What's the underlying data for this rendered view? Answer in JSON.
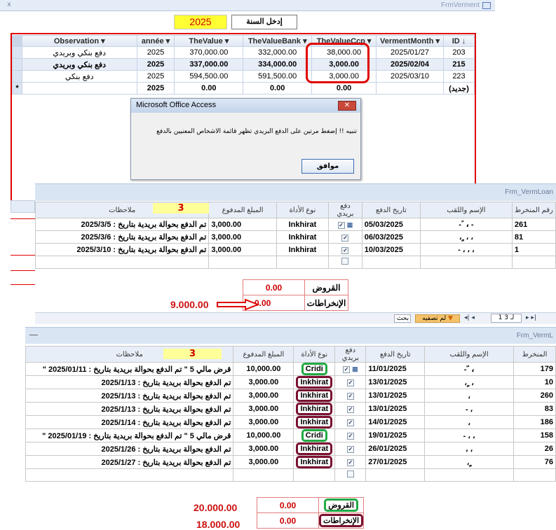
{
  "top_form": {
    "close_glyph": "x",
    "title": "FrmVerment",
    "year_value": "2025",
    "year_label": "إدخل السنة",
    "columns": [
      "Observation",
      "année",
      "TheValue",
      "TheValueBank",
      "TheValueCcp",
      "VermentMonth",
      "ID"
    ],
    "rows": [
      {
        "obs": "دفع بنكي وبريدي",
        "annee": "2025",
        "value": "370,000.00",
        "bank": "332,000.00",
        "ccp": "38,000.00",
        "month": "2025/01/27",
        "id": "203"
      },
      {
        "obs": "دفع بنكي وبريدي",
        "annee": "2025",
        "value": "337,000.00",
        "bank": "334,000.00",
        "ccp": "3,000.00",
        "month": "2025/02/04",
        "id": "215"
      },
      {
        "obs": "دفع بنكي",
        "annee": "2025",
        "value": "594,500.00",
        "bank": "591,500.00",
        "ccp": "3,000.00",
        "month": "2025/03/10",
        "id": "223"
      },
      {
        "obs": "",
        "annee": "2025",
        "value": "0.00",
        "bank": "0.00",
        "ccp": "0.00",
        "month": "",
        "id": "(جديد)"
      }
    ],
    "new_row_marker": "*"
  },
  "dialog": {
    "title": "Microsoft Office Access",
    "close": "✕",
    "message": "تنبيه !! إضغط مرتين على الدفع البريدي تظهر قائمة الاشخاص المعنيين بالدفع",
    "ok": "موافق"
  },
  "form2": {
    "title": "Frm_VermLoan",
    "headers": [
      "ملاحظات",
      "المبلغ المدفوع",
      "نوع الأداة",
      "دفع بريدي",
      "تاريخ الدفع",
      "الإسم واللقب",
      "رقم المنخرط"
    ],
    "count": "3",
    "rows": [
      {
        "note": "تم الدفع بحوالة بريدية بتاريخ :  2025/3/5",
        "amount": "3,000.00",
        "tool": "Inkhirat",
        "date": "05/03/2025",
        "name": "- ً ، -",
        "num": "261"
      },
      {
        "note": "تم الدفع بحوالة بريدية بتاريخ :  2025/3/6",
        "amount": "3,000.00",
        "tool": "Inkhirat",
        "date": "06/03/2025",
        "name": "، ٍ ، ،",
        "num": "81"
      },
      {
        "note": "تم الدفع بحوالة بريدية بتاريخ :  2025/3/10",
        "amount": "3,000.00",
        "tool": "Inkhirat",
        "date": "10/03/2025",
        "name": "- ، ، ،",
        "num": "1"
      }
    ],
    "loans_label": "القروض",
    "loans_value": "0.00",
    "inkhirat_label": "الإنخراطات",
    "inkhirat_value": "0.00",
    "annotation": "9.000.00",
    "nav": {
      "record": "1 لـ 3",
      "filter": "لم تصفيه",
      "search": "بحث"
    }
  },
  "form3": {
    "title": "Frm_VermL",
    "headers": [
      "ملاحظات",
      "المبلغ المدفوع",
      "نوع الأداة",
      "دفع بريدي",
      "تاريخ الدفع",
      "الإسم واللقب",
      "المنخرط"
    ],
    "count": "3",
    "rows": [
      {
        "note": "قرض مالي 5 \" تم الدفع بحوالة بريدية بتاريخ : 2025/01/11 \"",
        "amount": "10,000.00",
        "tool": "Cridi",
        "date": "11/01/2025",
        "name": "- ّ ،",
        "num": "179"
      },
      {
        "note": "تم الدفع بحوالة بريدية بتاريخ :  2025/1/13",
        "amount": "3,000.00",
        "tool": "Inkhirat",
        "date": "13/01/2025",
        "name": "، ٍ ،",
        "num": "10"
      },
      {
        "note": "تم الدفع بحوالة بريدية بتاريخ :  2025/1/13",
        "amount": "3,000.00",
        "tool": "Inkhirat",
        "date": "13/01/2025",
        "name": "،",
        "num": "260"
      },
      {
        "note": "تم الدفع بحوالة بريدية بتاريخ :  2025/1/13",
        "amount": "3,000.00",
        "tool": "Inkhirat",
        "date": "13/01/2025",
        "name": "- ،",
        "num": "83"
      },
      {
        "note": "تم الدفع بحوالة بريدية بتاريخ :  2025/1/14",
        "amount": "3,000.00",
        "tool": "Inkhirat",
        "date": "14/01/2025",
        "name": "،",
        "num": "186"
      },
      {
        "note": "قرض مالي 5 \" تم الدفع بحوالة بريدية بتاريخ : 2025/01/19 \"",
        "amount": "10,000.00",
        "tool": "Cridi",
        "date": "19/01/2025",
        "name": "- ، ،",
        "num": "158"
      },
      {
        "note": "تم الدفع بحوالة بريدية بتاريخ :  2025/1/26",
        "amount": "3,000.00",
        "tool": "Inkhirat",
        "date": "26/01/2025",
        "name": "، ،",
        "num": "26"
      },
      {
        "note": "تم الدفع بحوالة بريدية بتاريخ :  2025/1/27",
        "amount": "3,000.00",
        "tool": "Inkhirat",
        "date": "27/01/2025",
        "name": "، ٍ",
        "num": "76"
      }
    ],
    "loans_label": "القروض",
    "loans_value": "0.00",
    "inkhirat_label": "الإنخراطات",
    "inkhirat_value": "0.00",
    "annotation_loans": "20.000.00",
    "annotation_inkhirat": "18.000.00"
  },
  "colors": {
    "highlight_red": "#e00000",
    "year_yellow": "#ffff33",
    "green_oval": "#22aa44",
    "maroon_oval": "#7a1030"
  },
  "icons": [
    "grid-form-icon",
    "close-icon",
    "checkbox-icon",
    "calendar-icon",
    "red-arrow-icon"
  ]
}
